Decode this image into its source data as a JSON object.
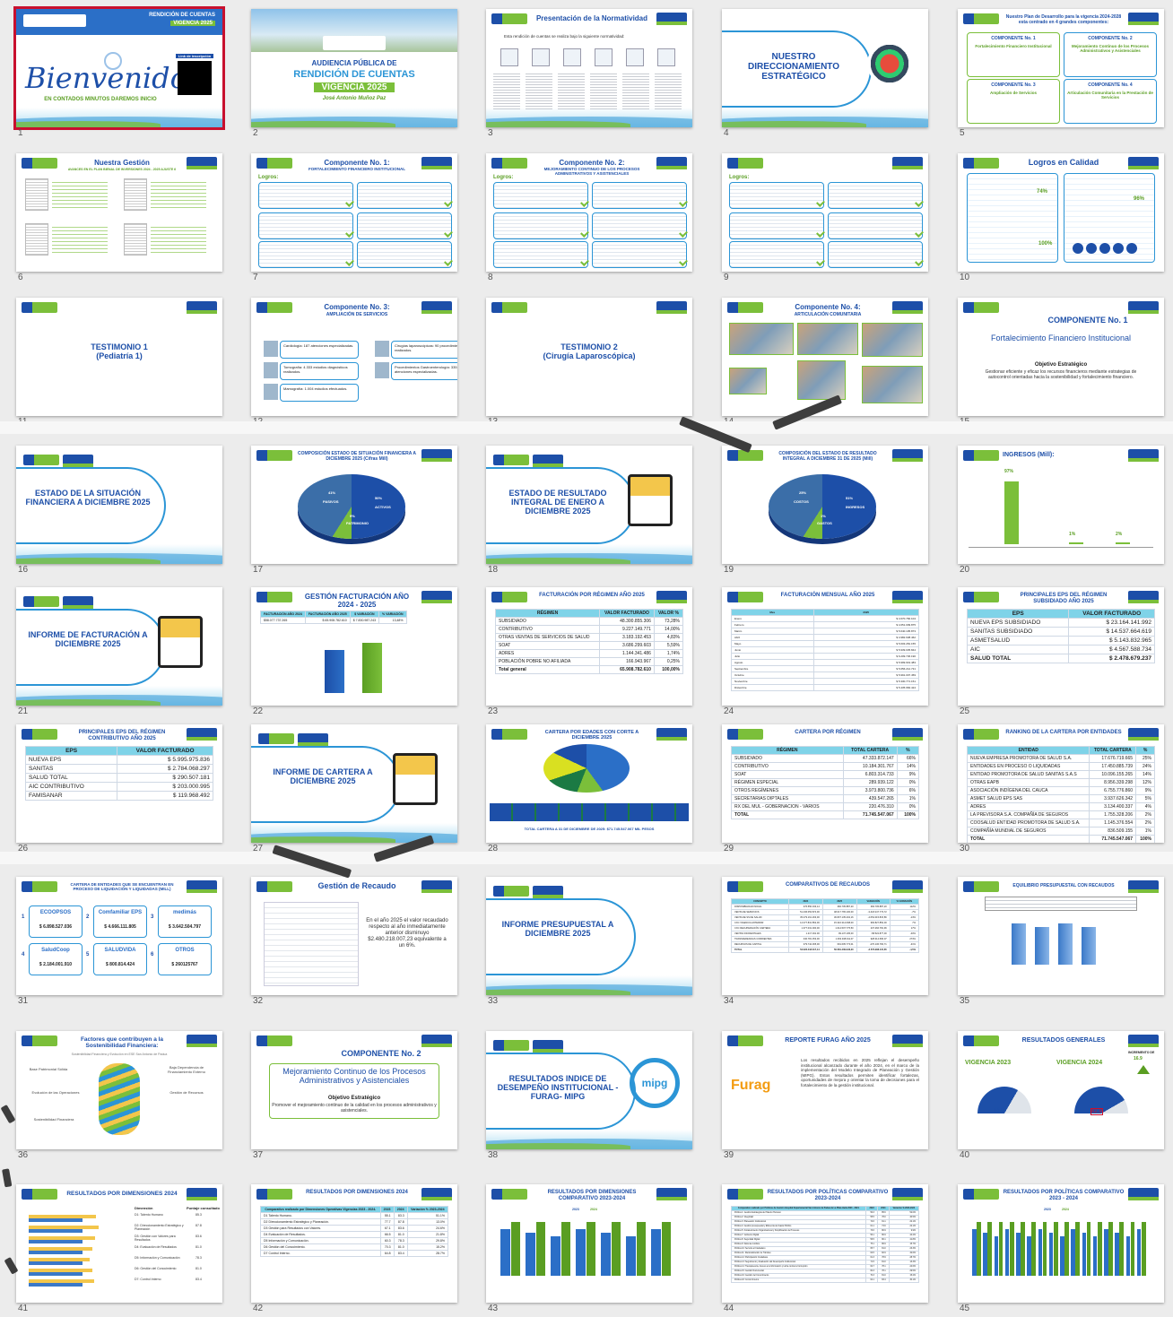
{
  "slides": [
    {
      "n": "1",
      "kind": "welcome",
      "title": "Bienvenidos",
      "subtitle": "EN CONTADOS MINUTOS DAREMOS INICIO",
      "badge": "RENDICIÓN DE CUENTAS",
      "year_badge": "VIGENCIA 2025",
      "qr_label": "Link de inscripción"
    },
    {
      "n": "2",
      "kind": "cover",
      "title": "AUDIENCIA PÚBLICA DE",
      "title2": "RENDICIÓN DE CUENTAS",
      "year": "VIGENCIA 2025",
      "person": "José Antonio Muñoz Paz"
    },
    {
      "n": "3",
      "kind": "docs",
      "title": "Presentación de la Normatividad",
      "intro": "Esta rendición de cuentas se realiza bajo la siguiente normatividad:"
    },
    {
      "n": "4",
      "kind": "section-icon",
      "title": "NUESTRO DIRECCIONAMIENTO ESTRATÉGICO"
    },
    {
      "n": "5",
      "kind": "grid4",
      "title": "Nuestro Plan de Desarrollo para la vigencia 2024-2028 esta centrado en 4 grandes componentes:",
      "items": [
        "COMPONENTE No. 1",
        "COMPONENTE No. 2",
        "COMPONENTE No. 3",
        "COMPONENTE No. 4"
      ],
      "subs": [
        "Fortalecimiento Financiero Institucional",
        "Mejoramiento Continuo de los Procesos Administrativos y Asistenciales",
        "Ampliación de Servicios",
        "Articulación Comunitaria en la Prestación de Servicios"
      ]
    },
    {
      "n": "6",
      "kind": "gestion",
      "title": "Nuestra Gestión",
      "subtitle": "AVANCES EN EL PLAN BIENAL DE INVERSIONES 2024 - 2025 AJUSTE 6"
    },
    {
      "n": "7",
      "kind": "logros",
      "title": "Componente No. 1:",
      "subtitle": "FORTALECIMIENTO FINANCIERO INSTITUCIONAL",
      "label": "Logros:"
    },
    {
      "n": "8",
      "kind": "logros",
      "title": "Componente No. 2:",
      "subtitle": "MEJORAMIENTO CONTINUO DE LOS PROCESOS ADMINISTRATIVOS Y ASISTENCIALES",
      "label": "Logros:"
    },
    {
      "n": "9",
      "kind": "logros",
      "title": "",
      "subtitle": "",
      "label": "Logros:"
    },
    {
      "n": "10",
      "kind": "calidad",
      "title": "Logros en Calidad",
      "p1": "74%",
      "p2": "96%",
      "p3": "100%"
    },
    {
      "n": "11",
      "kind": "plain",
      "title": "TESTIMONIO 1",
      "title2": "(Pediatría 1)"
    },
    {
      "n": "12",
      "kind": "servicios",
      "title": "Componente No. 3:",
      "subtitle": "AMPLIACIÓN DE SERVICIOS",
      "items": [
        "Cardiología: 187 atenciones especializadas.",
        "Cirugías laparoscópicas: 90 procedimientos realizados.",
        "Tomografía: 4.333 estudios diagnósticos realizados.",
        "Procedimientos Gastroenterología: 335 atenciones especializadas.",
        "Mamografía: 1.004 estudios efectuados."
      ]
    },
    {
      "n": "13",
      "kind": "plain",
      "title": "TESTIMONIO 2",
      "title2": "(Cirugía Laparoscópica)"
    },
    {
      "n": "14",
      "kind": "photos",
      "title": "Componente No. 4:",
      "subtitle": "ARTICULACIÓN COMUNITARIA"
    },
    {
      "n": "15",
      "kind": "component",
      "title": "COMPONENTE No. 1",
      "t2": "Fortalecimiento Financiero Institucional",
      "obj": "Objetivo Estratégico",
      "desc": "Gestionar eficiente y eficaz los recursos financieros mediante estrategias de autocontrol orientadas hacia la sostenibilidad y fortalecimiento financiero."
    },
    {
      "n": "16",
      "kind": "pill",
      "title": "ESTADO DE LA SITUACIÓN FINANCIERA A DICIEMBRE 2025"
    },
    {
      "n": "17",
      "kind": "pie",
      "title": "COMPOSICIÓN ESTADO DE SITUACIÓN FINANCIERA A DICIEMBRE 2025 (Cifras Mill)",
      "l1": "ACTIVOS",
      "l2": "PASIVOS",
      "l3": "PATRIMONIO",
      "v1": "50%",
      "v2": "41%",
      "v3": "9%"
    },
    {
      "n": "18",
      "kind": "pill-icon",
      "title": "ESTADO DE RESULTADO INTEGRAL DE ENERO A DICIEMBRE 2025"
    },
    {
      "n": "19",
      "kind": "pie",
      "title": "COMPOSICIÓN DEL ESTADO DE RESULTADO INTEGRAL A DICIEMBRE 31 DE 2025 (Mill)",
      "l1": "INGRESOS",
      "l2": "COSTOS",
      "l3": "GASTOS",
      "v1": "51%",
      "v2": "25%",
      "v3": "1%"
    },
    {
      "n": "20",
      "kind": "ingresos",
      "title": "INGRESOS (Mill):",
      "v1": "97%",
      "v2": "1%",
      "v3": "2%"
    },
    {
      "n": "21",
      "kind": "pill-icon",
      "title": "INFORME DE FACTURACIÓN A DICIEMBRE 2025"
    },
    {
      "n": "22",
      "kind": "bars2",
      "title": "GESTIÓN FACTURACIÓN AÑO 2024 - 2025",
      "h": [
        "FACTURACIÓN AÑO 2024",
        "FACTURACIÓN AÑO 2025",
        "$ VARIACIÓN",
        "% VARIACIÓN"
      ],
      "r": [
        "$58.077.737.265",
        "$ 65.908.782.610",
        "$ 7.830.987.243",
        "13,48%"
      ]
    },
    {
      "n": "23",
      "kind": "table",
      "title": "FACTURACIÓN POR RÉGIMEN AÑO 2025",
      "rows": [
        [
          "RÉGIMEN",
          "VALOR FACTURADO",
          "VALOR %"
        ],
        [
          "SUBSIDIADO",
          "48.300.855.306",
          "73,28%"
        ],
        [
          "CONTRIBUTIVO",
          "9.227.149.771",
          "14,00%"
        ],
        [
          "OTRAS VENTAS DE SERVICIOS DE SALUD",
          "3.183.192.453",
          "4,83%"
        ],
        [
          "SOAT",
          "3.686.299.603",
          "5,59%"
        ],
        [
          "ADRES",
          "1.144.341.486",
          "1,74%"
        ],
        [
          "POBLACIÓN POBRE NO AFILIADA",
          "166.943.967",
          "0,25%"
        ],
        [
          "Total general",
          "65.908.782.610",
          "100,00%"
        ]
      ]
    },
    {
      "n": "24",
      "kind": "table",
      "title": "FACTURACIÓN MENSUAL AÑO 2025",
      "rows": [
        [
          "Mes",
          "2025"
        ],
        [
          "Enero",
          "$ 4.670.782.104"
        ],
        [
          "Febrero",
          "$ 4.651.009.875"
        ],
        [
          "Marzo",
          "$ 5.640.105.873"
        ],
        [
          "Abril",
          "$ 4.982.938.462"
        ],
        [
          "Mayo",
          "$ 5.603.281.155"
        ],
        [
          "Junio",
          "$ 5.939.035.844"
        ],
        [
          "Julio",
          "$ 6.209.736.190"
        ],
        [
          "Agosto",
          "$ 5.999.919.483"
        ],
        [
          "Septiembre",
          "$ 5.656.212.731"
        ],
        [
          "Octubre",
          "$ 5.991.007.459"
        ],
        [
          "Noviembre",
          "$ 5.330.771.151"
        ],
        [
          "Diciembre",
          "$ 5.435.984.424"
        ]
      ]
    },
    {
      "n": "25",
      "kind": "table",
      "title": "PRINCIPALES EPS DEL RÉGIMEN SUBSIDIADO AÑO 2025",
      "rows": [
        [
          "EPS",
          "VALOR FACTURADO"
        ],
        [
          "NUEVA EPS SUBSIDIADO",
          "$ 23.164.141.992"
        ],
        [
          "SANITAS SUBSIDIADO",
          "$ 14.537.664.619"
        ],
        [
          "ASMETSALUD",
          "$ 5.143.832.965"
        ],
        [
          "AIC",
          "$ 4.567.588.734"
        ],
        [
          "SALUD TOTAL",
          "$ 2.478.679.237"
        ]
      ]
    },
    {
      "n": "26",
      "kind": "table",
      "title": "PRINCIPALES EPS DEL RÉGIMEN CONTRIBUTIVO AÑO 2025",
      "rows": [
        [
          "EPS",
          "VALOR FACTURADO"
        ],
        [
          "NUEVA EPS",
          "$ 5.995.975.836"
        ],
        [
          "SANITAS",
          "$ 2.784.068.297"
        ],
        [
          "SALUD TOTAL",
          "$ 290.507.181"
        ],
        [
          "AIC CONTRIBUTIVO",
          "$ 203.000.995"
        ],
        [
          "FAMISANAR",
          "$ 119.968.492"
        ]
      ]
    },
    {
      "n": "27",
      "kind": "pill-icon",
      "title": "INFORME DE CARTERA A DICIEMBRE 2025"
    },
    {
      "n": "28",
      "kind": "cartera",
      "title": "CARTERA POR EDADES CON CORTE A DICIEMBRE 2025",
      "total": "TOTAL CARTERA A 31 DE DICIEMBRE DE 2025: $71.745.547.067 MIL PESOS"
    },
    {
      "n": "29",
      "kind": "table",
      "title": "CARTERA POR RÉGIMEN",
      "rows": [
        [
          "RÉGIMEN",
          "TOTAL CARTERA",
          "%"
        ],
        [
          "SUBSIDIADO",
          "47.333.872.147",
          "66%"
        ],
        [
          "CONTRIBUTIVO",
          "10.184.301.767",
          "14%"
        ],
        [
          "SOAT",
          "6.803.314.733",
          "9%"
        ],
        [
          "RÉGIMEN ESPECIAL",
          "289.939.122",
          "0%"
        ],
        [
          "OTROS REGÍMENES",
          "3.973.800.736",
          "6%"
        ],
        [
          "SECRETARIAS DIPTALES",
          "439.547.265",
          "1%"
        ],
        [
          "RX DEL MUL - GOBERNACION - VARIOS",
          "220.476.310",
          "0%"
        ],
        [
          "TOTAL",
          "71.745.547.067",
          "100%"
        ]
      ]
    },
    {
      "n": "30",
      "kind": "table",
      "title": "RANKING DE LA CARTERA POR ENTIDADES",
      "rows": [
        [
          "ENTIDAD",
          "TOTAL CARTERA",
          "%"
        ],
        [
          "NUEVA EMPRESA PROMOTORA DE SALUD S.A.",
          "17.676.719.665",
          "25%"
        ],
        [
          "ENTIDADES EN PROCESO O LIQUIDADAS",
          "17.450.885.739",
          "24%"
        ],
        [
          "ENTIDAD PROMOTORA DE SALUD SANITAS S.A.S",
          "10.096.155.265",
          "14%"
        ],
        [
          "OTRAS EAPB",
          "8.956.339.298",
          "12%"
        ],
        [
          "ASOCIACIÓN INDÍGENA DEL CAUCA",
          "6.755.776.860",
          "9%"
        ],
        [
          "ASMET SALUD EPS SAS",
          "3.937.626.342",
          "5%"
        ],
        [
          "ADRES",
          "3.134.400.337",
          "4%"
        ],
        [
          "LA PREVISORA S.A. COMPAÑÍA DE SEGUROS",
          "1.755.328.206",
          "2%"
        ],
        [
          "COOSALUD ENTIDAD PROMOTORA DE SALUD S.A.",
          "1.145.376.554",
          "2%"
        ],
        [
          "COMPAÑÍA MUNDIAL DE SEGUROS",
          "836.509.155",
          "1%"
        ],
        [
          "TOTAL",
          "71.745.547.067",
          "100%"
        ]
      ]
    },
    {
      "n": "31",
      "kind": "liquidadas",
      "title": "CARTERA DE ENTIDADES QUE SE ENCUENTRAN EN PROCESO DE LIQUIDACIÓN Y LIQUIDADAS (MILL)",
      "items": [
        [
          "1",
          "ECOOPSOS",
          "$ 6.898.527.036"
        ],
        [
          "2",
          "Comfamiliar EPS",
          "$ 4.666.111.805"
        ],
        [
          "3",
          "medimás",
          "$ 3.642.504.797"
        ],
        [
          "4",
          "SaludCoop",
          "$ 2.184.001.910"
        ],
        [
          "5",
          "SALUDVIDA",
          "$ 800.814.424"
        ],
        [
          "6",
          "OTROS",
          "$ 260125767"
        ]
      ]
    },
    {
      "n": "32",
      "kind": "recaudo",
      "title": "Gestión de Recaudo",
      "text": "En el año 2025 el valor recaudado respecto al año inmediatamente anterior disminuyo $2.480.218.007,23 equivalente a un 6%."
    },
    {
      "n": "33",
      "kind": "pill",
      "title": "INFORME PRESUPUESTAL A DICIEMBRE 2025"
    },
    {
      "n": "34",
      "kind": "table",
      "title": "COMPARATIVOS DE RECAUDOS",
      "rows": [
        [
          "CONCEPTO",
          "2024",
          "2025",
          "VARIACIÓN",
          "% VARIACIÓN"
        ],
        [
          "DISPONIBILIDAD INICIAL",
          "376.550.333,14",
          "366.705.887,20",
          "366.705.887,20",
          "112%"
        ],
        [
          "VENTA DE SERVICIOS",
          "51.436.053.874,00",
          "48.017.765.100,00",
          "-3.418.247.773,72",
          "-7%"
        ],
        [
          "VENTA DE SS DE SALUD",
          "35.479.161.263,00",
          "30.837.135.402,16",
          "-4.652.015.815,86",
          "-13%"
        ],
        [
          "CXC VIGENCIA ANTERIOR",
          "14.377.831.852,00",
          "15.316.314.698,00",
          "966.827.852,00",
          "7%"
        ],
        [
          "CXC RECUPERACIÓN CARTERA",
          "1.377.031.000,00",
          "1.614.507.775,50",
          "237.266.781,96",
          "17%"
        ],
        [
          "VENTAS INCIDENTALES",
          "1.217.031.00",
          "99.137.195,00",
          "-58.522.877,00",
          "-40%"
        ],
        [
          "TRANSFERENCIAS CORRIENTES",
          "340.781.353,00",
          "1.363.948.911,07",
          "928.314.696,07",
          "273%"
        ],
        [
          "RECURSOS DE CAPITAL",
          "379.742.365,00",
          "691.605.773,01",
          "-276.136.784,71",
          "-31%"
        ],
        [
          "TOTAL",
          "53.022.418.317,14",
          "50.581.409.946,20",
          "-2.573.996.115,65",
          "-4,5%"
        ]
      ]
    },
    {
      "n": "35",
      "kind": "equilibrio",
      "title": "EQUILIBRIO PRESUPUESTAL CON RECAUDOS"
    },
    {
      "n": "36",
      "kind": "dna",
      "title": "Factores que contribuyen a la Sostenibilidad Financiera:",
      "sub": "Sostenibilidad Financiera y Evolución en ESE San Antonio de Padua",
      "labels": [
        "Base Patrimonial Sólida",
        "Baja Dependencia de Financiamiento Externo",
        "Evolución de las Operaciones",
        "Gestión de Recursos",
        "Sostenibilidad Financiera"
      ]
    },
    {
      "n": "37",
      "kind": "component2",
      "title": "COMPONENTE No. 2",
      "t2": "Mejoramiento Continuo de los Procesos Administrativos y Asistenciales",
      "obj": "Objetivo Estratégico",
      "desc": "Promover el mejoramiento continuo de la calidad en los procesos administrativos y asistenciales."
    },
    {
      "n": "38",
      "kind": "pill-mipg",
      "title": "RESULTADOS INDICE DE DESEMPEÑO INSTITUCIONAL - FURAG- MIPG",
      "logo": "mipg"
    },
    {
      "n": "39",
      "kind": "furag",
      "title": "REPORTE FURAG AÑO 2025",
      "logo": "Furag",
      "text": "Los resultados recibidos en 2025 reflejan el desempeño institucional alcanzado durante el año 2024, en el marco de la implementación del Modelo Integrado de Planeación y Gestión (MIPG). Estos resultados permiten identificar fortalezas, oportunidades de mejora y orientar la toma de decisiones para el fortalecimiento de la gestión institucional."
    },
    {
      "n": "40",
      "kind": "gauges",
      "title": "RESULTADOS GENERALES",
      "y1": "VIGENCIA 2023",
      "y2": "VIGENCIA 2024",
      "g1": "66.0",
      "g2": "82.9",
      "inc": "INCREMENTO DE",
      "pts": "16.9",
      "ptsl": "PUNTOS"
    },
    {
      "n": "41",
      "kind": "hbars",
      "title": "RESULTADOS POR DIMENSIONES 2024",
      "cols": [
        "Dimensión",
        "Puntaje consultado"
      ],
      "rows": [
        [
          "D1: Talento Humano",
          "85.3"
        ],
        [
          "D2: Direccionamiento Estratégico y Planeación",
          "87.8"
        ],
        [
          "D3: Gestión con Valores para Resultados",
          "83.6"
        ],
        [
          "D4: Evaluación de Resultados",
          "81.0"
        ],
        [
          "D5: Información y Comunicación",
          "78.3"
        ],
        [
          "D6: Gestión del Conocimiento",
          "81.0"
        ],
        [
          "D7: Control Interno",
          "83.4"
        ]
      ]
    },
    {
      "n": "42",
      "kind": "table",
      "title": "RESULTADOS POR DIMENSIONES 2024",
      "rows": [
        [
          "Comparativo realizado por Dimensiones Operativas Vigencias 2023 - 2024.",
          "2023",
          "2024",
          "Variación % 2023-2024"
        ],
        [
          "D1 Talento Humano.",
          "55.1",
          "83.3",
          "51.1%"
        ],
        [
          "D2 Direccionamiento Estratégico y Planeación.",
          "77.7",
          "87.8",
          "13.0%"
        ],
        [
          "D3 Gestión para Resultados con Valores.",
          "67.1",
          "83.6",
          "24.6%"
        ],
        [
          "D4 Evaluación de Resultados.",
          "66.5",
          "81.0",
          "21.8%"
        ],
        [
          "D5 Información y Comunicación.",
          "60.3",
          "78.3",
          "29.8%"
        ],
        [
          "D6 Gestión del Conocimiento.",
          "70.3",
          "81.0",
          "15.2%"
        ],
        [
          "D7 Control Interno.",
          "64.8",
          "83.4",
          "28.7%"
        ]
      ]
    },
    {
      "n": "43",
      "kind": "groupbars",
      "title": "RESULTADOS POR DIMENSIONES COMPARATIVO 2023-2024",
      "legend": [
        "2023",
        "2024"
      ]
    },
    {
      "n": "44",
      "kind": "table",
      "title": "RESULTADOS POR POLÍTICAS COMPARATIVO 2023-2024",
      "rows": [
        [
          "Comparativo realizado por Políticas de Gestión Hospital Departamental San Antonio de Padua de La Plata Huila 2023 - 2024.",
          "2023",
          "2024",
          "Variación % 2023-2024"
        ],
        [
          "Política 1: Gestión Estratégica del Talento Humano",
          "56.3",
          "85.6",
          "52.0%"
        ],
        [
          "Política 2: Integridad",
          "55.5",
          "78.0",
          "40.5%"
        ],
        [
          "Política 3: Planeación Institucional",
          "74.6",
          "91.1",
          "22.1%"
        ],
        [
          "Política 4: Gestión presupuestal y Eficiencia del Gasto Público",
          "61.1",
          "74.6",
          "22.1%"
        ],
        [
          "Política 5: Fortalecimiento Organizacional y Simplificación de Procesos",
          "73.6",
          "80.9",
          "9.9%"
        ],
        [
          "Política 7: Gobierno Digital",
          "56.1",
          "80.9",
          "44.2%"
        ],
        [
          "Política 8: Seguridad Digital",
          "56.5",
          "80.1",
          "41.8%"
        ],
        [
          "Política 9: Defensa Jurídica",
          "75.1",
          "86.9",
          "15.7%"
        ],
        [
          "Política 10: Servicio al Ciudadano",
          "65.7",
          "81.0",
          "23.3%"
        ],
        [
          "Política 11: Racionalización de Trámites",
          "62.5",
          "82.9",
          "32.6%"
        ],
        [
          "Política 12: Participación Ciudadana",
          "61.3",
          "78.9",
          "28.7%"
        ],
        [
          "Política 13: Seguimiento y Evaluación del Desempeño Institucional",
          "71.5",
          "81.0",
          "13.3%"
        ],
        [
          "Política 14: Transparencia, Acceso a la Información y lucha contra la Corrupción",
          "62.7",
          "78.1",
          "24.6%"
        ],
        [
          "Política 15: Gestión Documental",
          "60.3",
          "78.1",
          "29.5%"
        ],
        [
          "Política 16: Gestión del Conocimiento",
          "70.3",
          "81.0",
          "15.2%"
        ],
        [
          "Política 18: Control Interno",
          "64.1",
          "83.4",
          "30.1%"
        ]
      ]
    },
    {
      "n": "45",
      "kind": "groupbars",
      "title": "RESULTADOS POR POLÍTICAS COMPARATIVO 2023 - 2024",
      "legend": [
        "2023",
        "2024"
      ]
    }
  ],
  "colors": {
    "brand_blue": "#1d4fa8",
    "brand_green": "#7bbf3a",
    "accent_red": "#c8102e",
    "light_cyan": "#7fd3e8"
  }
}
